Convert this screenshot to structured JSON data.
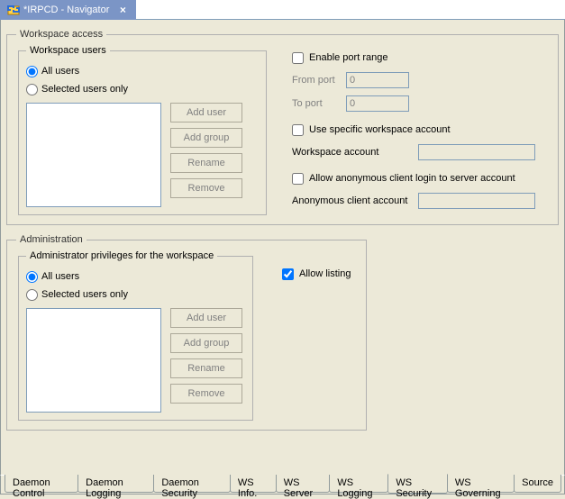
{
  "tab": {
    "title": "*IRPCD - Navigator"
  },
  "workspace_access": {
    "legend": "Workspace access",
    "users": {
      "legend": "Workspace users",
      "radio_all": "All users",
      "radio_selected": "Selected users only",
      "selected": "all",
      "btn_add_user": "Add user",
      "btn_add_group": "Add group",
      "btn_rename": "Rename",
      "btn_remove": "Remove"
    },
    "port": {
      "enable_label": "Enable port range",
      "enabled": false,
      "from_label": "From port",
      "from_value": "0",
      "to_label": "To port",
      "to_value": "0"
    },
    "specific_account": {
      "checkbox_label": "Use specific workspace account",
      "checked": false,
      "field_label": "Workspace account",
      "value": ""
    },
    "anonymous": {
      "checkbox_label": "Allow anonymous client login to server account",
      "checked": false,
      "field_label": "Anonymous client account",
      "value": ""
    }
  },
  "administration": {
    "legend": "Administration",
    "privs": {
      "legend": "Administrator privileges for the workspace",
      "radio_all": "All users",
      "radio_selected": "Selected users only",
      "selected": "all",
      "btn_add_user": "Add user",
      "btn_add_group": "Add group",
      "btn_rename": "Rename",
      "btn_remove": "Remove"
    },
    "allow_listing": {
      "label": "Allow listing",
      "checked": true
    }
  },
  "bottom_tabs": {
    "items": [
      "Daemon Control",
      "Daemon Logging",
      "Daemon Security",
      "WS Info.",
      "WS Server",
      "WS Logging",
      "WS Security",
      "WS Governing",
      "Source"
    ],
    "active_index": 6
  }
}
